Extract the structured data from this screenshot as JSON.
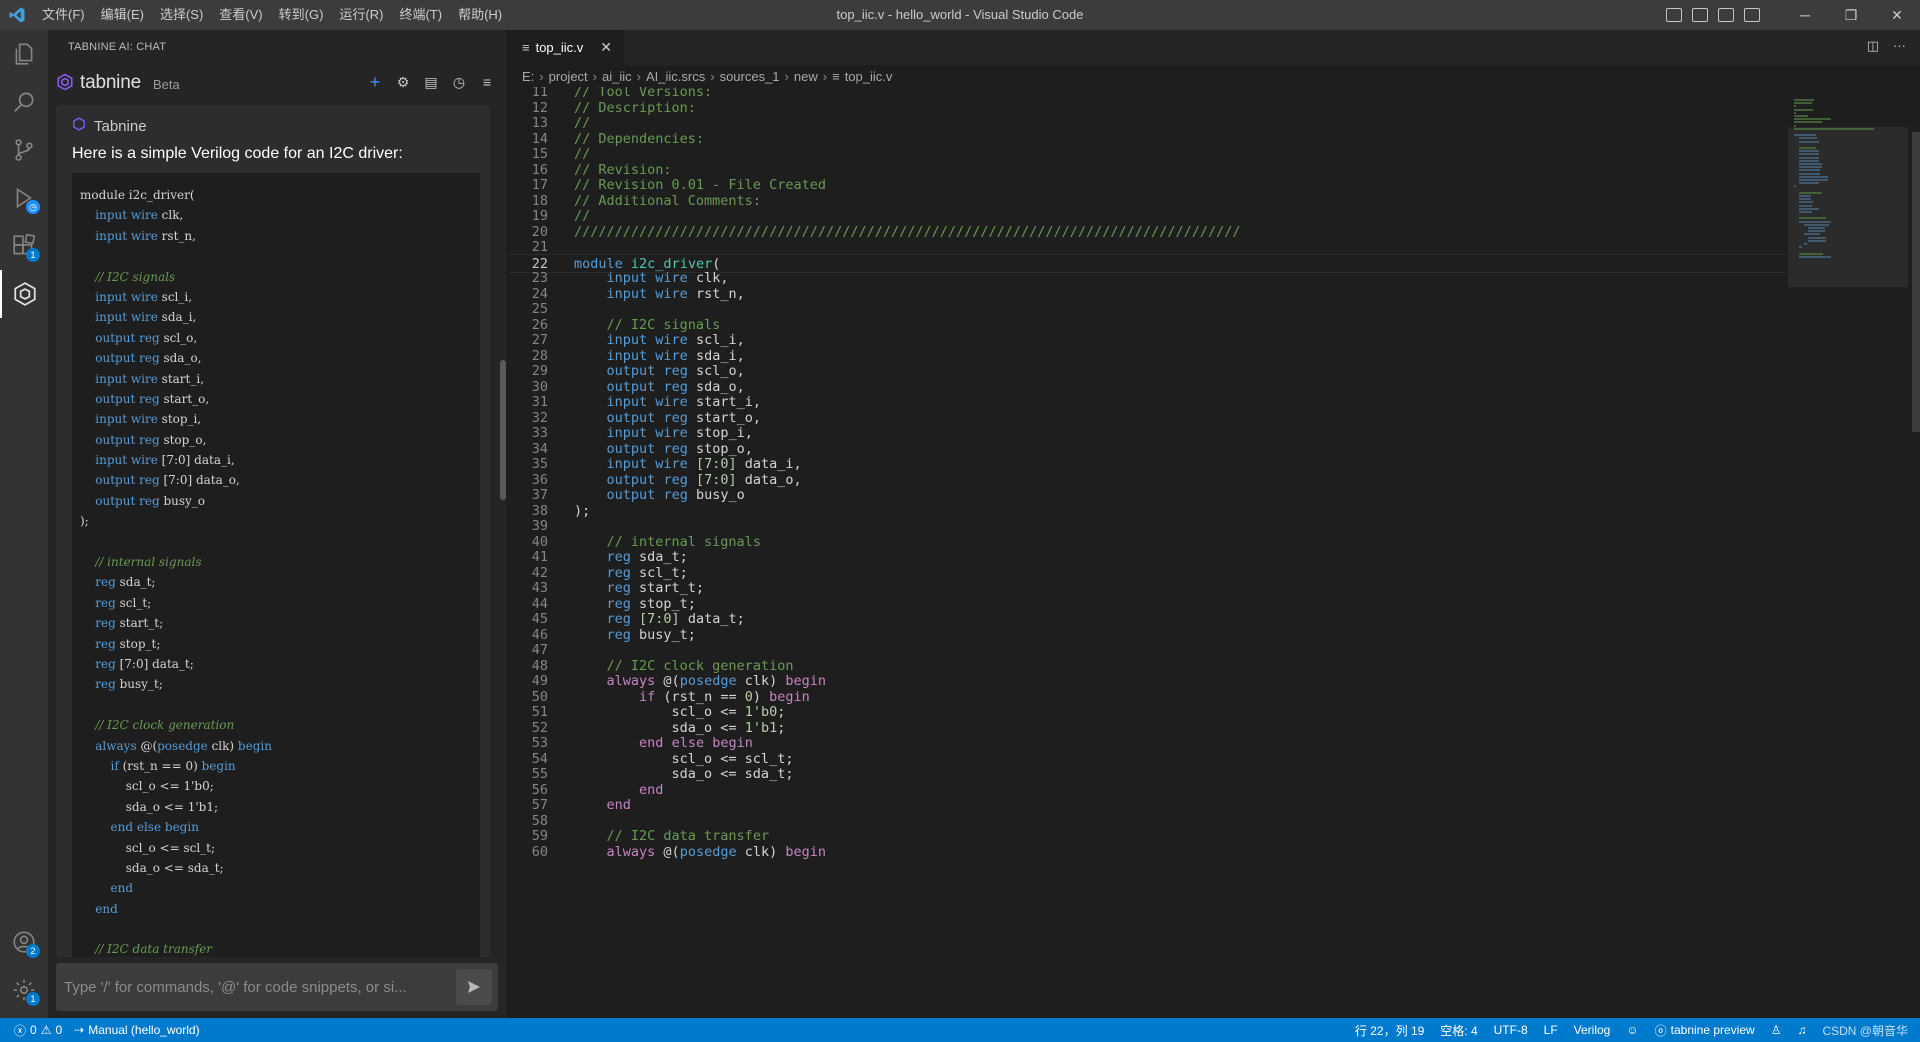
{
  "window": {
    "title": "top_iic.v - hello_world - Visual Studio Code",
    "menu": [
      "文件(F)",
      "编辑(E)",
      "选择(S)",
      "查看(V)",
      "转到(G)",
      "运行(R)",
      "终端(T)",
      "帮助(H)"
    ]
  },
  "activity": {
    "badges": {
      "extensions": "1",
      "accounts": "2",
      "settings": "1"
    }
  },
  "sidebar": {
    "title": "TABNINE AI: CHAT",
    "brand": "tabnine",
    "beta": "Beta",
    "chat": {
      "sender": "Tabnine",
      "intro": "Here is a simple Verilog code for an I2C driver:",
      "code_lines": [
        "module i2c_driver(",
        "    input wire clk,",
        "    input wire rst_n,",
        "",
        "    // I2C signals",
        "    input wire scl_i,",
        "    input wire sda_i,",
        "    output reg scl_o,",
        "    output reg sda_o,",
        "    input wire start_i,",
        "    output reg start_o,",
        "    input wire stop_i,",
        "    output reg stop_o,",
        "    input wire [7:0] data_i,",
        "    output reg [7:0] data_o,",
        "    output reg busy_o",
        ");",
        "",
        "    // internal signals",
        "    reg sda_t;",
        "    reg scl_t;",
        "    reg start_t;",
        "    reg stop_t;",
        "    reg [7:0] data_t;",
        "    reg busy_t;",
        "",
        "    // I2C clock generation",
        "    always @(posedge clk) begin",
        "        if (rst_n == 0) begin",
        "            scl_o <= 1'b0;",
        "            sda_o <= 1'b1;",
        "        end else begin",
        "            scl_o <= scl_t;",
        "            sda_o <= sda_t;",
        "        end",
        "    end",
        "",
        "    // I2C data transfer"
      ]
    },
    "input_placeholder": "Type '/' for commands, '@' for code snippets, or si..."
  },
  "editor": {
    "tab": {
      "label": "top_iic.v"
    },
    "breadcrumb": [
      "E:",
      "project",
      "ai_iic",
      "AI_iic.srcs",
      "sources_1",
      "new",
      "top_iic.v"
    ],
    "current_line": 22,
    "lines": [
      {
        "n": 11,
        "t": "// Tool Versions:"
      },
      {
        "n": 12,
        "t": "// Description:"
      },
      {
        "n": 13,
        "t": "//"
      },
      {
        "n": 14,
        "t": "// Dependencies:"
      },
      {
        "n": 15,
        "t": "//"
      },
      {
        "n": 16,
        "t": "// Revision:"
      },
      {
        "n": 17,
        "t": "// Revision 0.01 - File Created"
      },
      {
        "n": 18,
        "t": "// Additional Comments:"
      },
      {
        "n": 19,
        "t": "//"
      },
      {
        "n": 20,
        "t": "//////////////////////////////////////////////////////////////////////////////////"
      },
      {
        "n": 21,
        "t": ""
      },
      {
        "n": 22,
        "t": "module i2c_driver("
      },
      {
        "n": 23,
        "t": "    input wire clk,"
      },
      {
        "n": 24,
        "t": "    input wire rst_n,"
      },
      {
        "n": 25,
        "t": ""
      },
      {
        "n": 26,
        "t": "    // I2C signals"
      },
      {
        "n": 27,
        "t": "    input wire scl_i,"
      },
      {
        "n": 28,
        "t": "    input wire sda_i,"
      },
      {
        "n": 29,
        "t": "    output reg scl_o,"
      },
      {
        "n": 30,
        "t": "    output reg sda_o,"
      },
      {
        "n": 31,
        "t": "    input wire start_i,"
      },
      {
        "n": 32,
        "t": "    output reg start_o,"
      },
      {
        "n": 33,
        "t": "    input wire stop_i,"
      },
      {
        "n": 34,
        "t": "    output reg stop_o,"
      },
      {
        "n": 35,
        "t": "    input wire [7:0] data_i,"
      },
      {
        "n": 36,
        "t": "    output reg [7:0] data_o,"
      },
      {
        "n": 37,
        "t": "    output reg busy_o"
      },
      {
        "n": 38,
        "t": ");"
      },
      {
        "n": 39,
        "t": ""
      },
      {
        "n": 40,
        "t": "    // internal signals"
      },
      {
        "n": 41,
        "t": "    reg sda_t;"
      },
      {
        "n": 42,
        "t": "    reg scl_t;"
      },
      {
        "n": 43,
        "t": "    reg start_t;"
      },
      {
        "n": 44,
        "t": "    reg stop_t;"
      },
      {
        "n": 45,
        "t": "    reg [7:0] data_t;"
      },
      {
        "n": 46,
        "t": "    reg busy_t;"
      },
      {
        "n": 47,
        "t": ""
      },
      {
        "n": 48,
        "t": "    // I2C clock generation"
      },
      {
        "n": 49,
        "t": "    always @(posedge clk) begin"
      },
      {
        "n": 50,
        "t": "        if (rst_n == 0) begin"
      },
      {
        "n": 51,
        "t": "            scl_o <= 1'b0;"
      },
      {
        "n": 52,
        "t": "            sda_o <= 1'b1;"
      },
      {
        "n": 53,
        "t": "        end else begin"
      },
      {
        "n": 54,
        "t": "            scl_o <= scl_t;"
      },
      {
        "n": 55,
        "t": "            sda_o <= sda_t;"
      },
      {
        "n": 56,
        "t": "        end"
      },
      {
        "n": 57,
        "t": "    end"
      },
      {
        "n": 58,
        "t": ""
      },
      {
        "n": 59,
        "t": "    // I2C data transfer"
      },
      {
        "n": 60,
        "t": "    always @(posedge clk) begin"
      }
    ]
  },
  "statusbar": {
    "errors": "0",
    "warnings": "0",
    "run_config": "Manual (hello_world)",
    "position": "行 22，列 19",
    "indent": "空格: 4",
    "encoding": "UTF-8",
    "eol": "LF",
    "language": "Verilog",
    "tabnine": "tabnine preview",
    "watermark": "CSDN @朝音华"
  },
  "colors": {
    "accent": "#007acc",
    "tabnine_purple": "#8b5cf6",
    "comment": "#6a9955",
    "keyword": "#569cd6"
  }
}
